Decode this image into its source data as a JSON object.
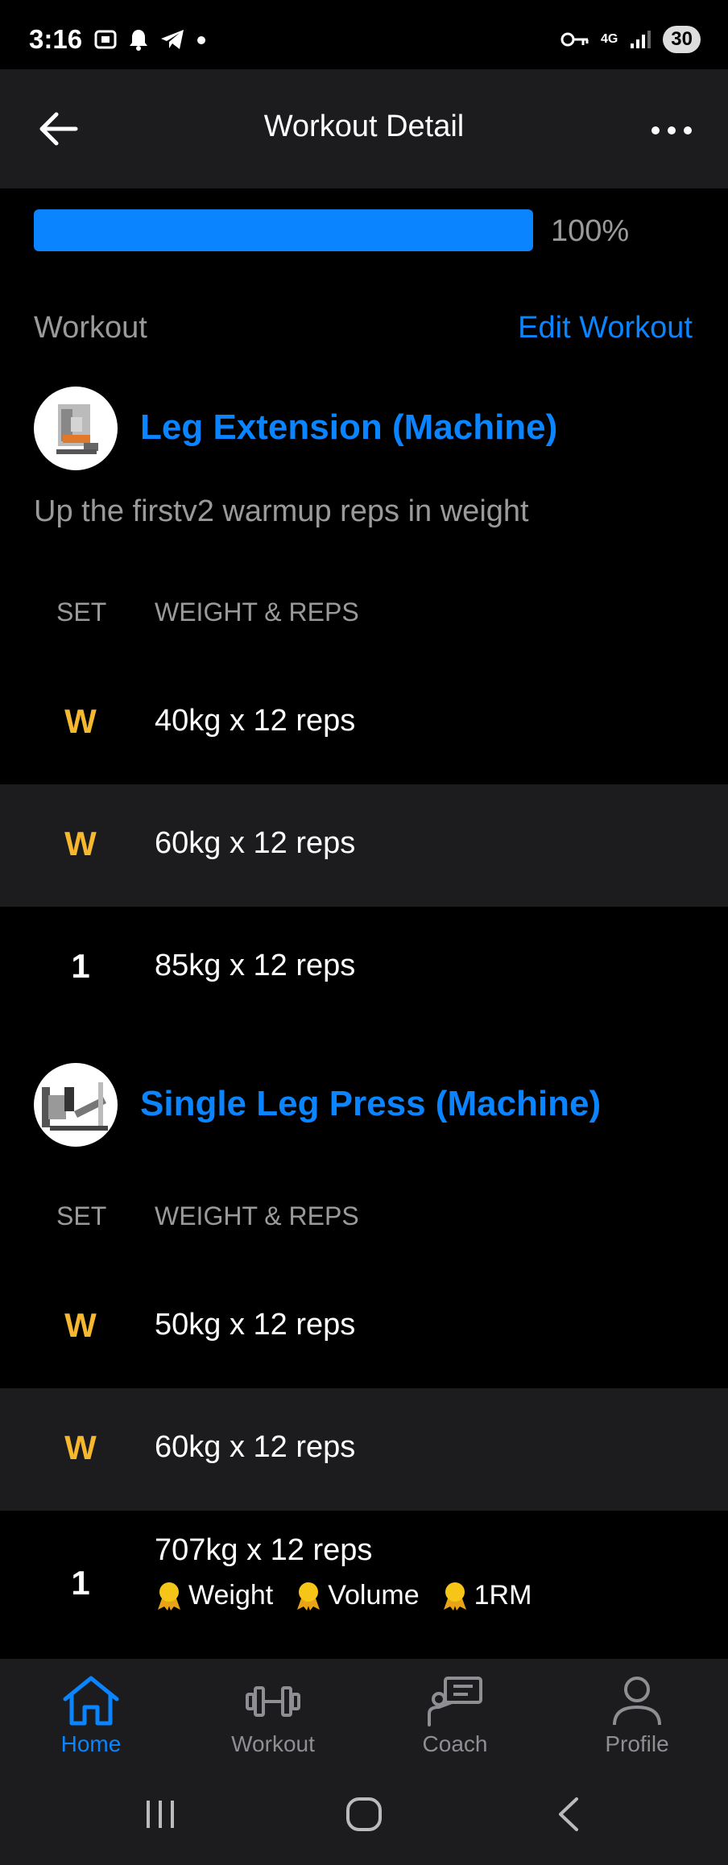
{
  "status_bar": {
    "time": "3:16",
    "network": "4G",
    "battery": "30"
  },
  "app_bar": {
    "title": "Workout Detail"
  },
  "progress": {
    "value": 1.0,
    "label": "100%"
  },
  "section": {
    "heading": "Workout",
    "edit_label": "Edit Workout"
  },
  "exercises": [
    {
      "name": "Leg Extension (Machine)",
      "note": "Up the firstv2 warmup reps in weight",
      "columns": {
        "set": "SET",
        "weight_reps": "WEIGHT & REPS"
      },
      "sets": [
        {
          "set": "W",
          "text": "40kg x 12 reps"
        },
        {
          "set": "W",
          "text": "60kg x 12 reps"
        },
        {
          "set": "1",
          "text": "85kg x 12 reps"
        }
      ]
    },
    {
      "name": "Single Leg Press (Machine)",
      "columns": {
        "set": "SET",
        "weight_reps": "WEIGHT & REPS"
      },
      "sets": [
        {
          "set": "W",
          "text": "50kg x 12 reps"
        },
        {
          "set": "W",
          "text": "60kg x 12 reps"
        },
        {
          "set": "1",
          "text": "707kg x 12 reps",
          "records": [
            "Weight",
            "Volume",
            "1RM"
          ]
        }
      ]
    }
  ],
  "bottom_nav": {
    "items": [
      {
        "label": "Home",
        "icon": "home-icon",
        "active": true
      },
      {
        "label": "Workout",
        "icon": "dumbbell-icon",
        "active": false
      },
      {
        "label": "Coach",
        "icon": "coach-icon",
        "active": false
      },
      {
        "label": "Profile",
        "icon": "profile-icon",
        "active": false
      }
    ]
  },
  "colors": {
    "accent": "#0a84ff",
    "warmup": "#f5b82e",
    "muted": "#9a9a9a",
    "surface": "#1c1c1e",
    "background": "#000000"
  }
}
